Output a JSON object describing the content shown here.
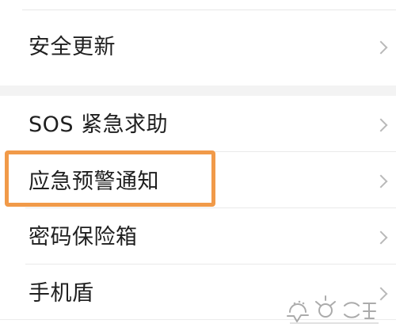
{
  "settings_list": {
    "items": [
      {
        "label": "安全更新"
      },
      {
        "label": "SOS 紧急求助"
      },
      {
        "label": "应急预警通知"
      },
      {
        "label": "密码保险箱"
      },
      {
        "label": "手机盾"
      }
    ]
  },
  "annotations": {
    "highlight_color": "#f19a49"
  },
  "icons": {
    "chevron": "chevron-right-icon",
    "watermark": "baidu-jingyan-watermark"
  },
  "colors": {
    "background": "#ffffff",
    "group_gap": "#f3f3f3",
    "text": "#1f1f1f",
    "chevron": "#b9b9b9"
  }
}
